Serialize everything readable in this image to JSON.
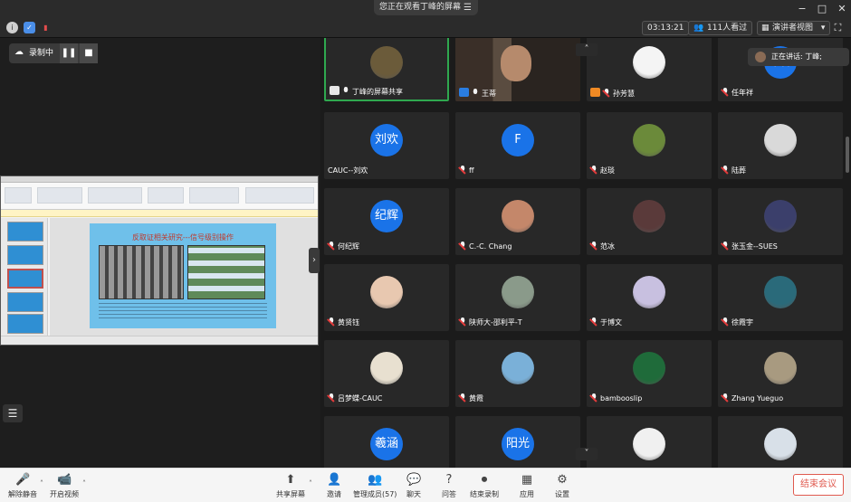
{
  "window": {
    "title": "您正在观看丁峰的屏幕",
    "menu_icon": "menu-icon",
    "controls": [
      "−",
      "□",
      "✕"
    ]
  },
  "toolbar": {
    "timer": "03:13:21",
    "viewer_count": "111人看过",
    "view_mode": "演讲者视图",
    "view_caret": "▾"
  },
  "recording": {
    "label": "录制中",
    "pause_icon": "❚❚",
    "stop_icon": "■"
  },
  "slide": {
    "title": "反取证相关研究---信号级别操作"
  },
  "speaking": {
    "text": "正在讲话: 丁峰;"
  },
  "participants": [
    {
      "name": "丁峰的屏幕共享",
      "kind": "share",
      "avatar": "img",
      "color": "#6b5b3a",
      "muted": false,
      "active": true,
      "icon": "screen-share-icon"
    },
    {
      "name": "王蒂",
      "kind": "host",
      "avatar": "video",
      "color": "#4a4440",
      "muted": false,
      "icon": "host-icon"
    },
    {
      "name": "孙芳慧",
      "kind": "cohost",
      "avatar": "img",
      "color": "#f4f4f4",
      "muted": true,
      "icon": "cohost-icon"
    },
    {
      "name": "任年祥",
      "avatar": "text",
      "text": "年祥",
      "color": "#1a73e8",
      "muted": true
    },
    {
      "name": "CAUC--刘欢",
      "avatar": "text",
      "text": "刘欢",
      "color": "#1a73e8",
      "muted": null
    },
    {
      "name": "ff",
      "avatar": "text",
      "text": "F",
      "color": "#1a73e8",
      "muted": true
    },
    {
      "name": "赵琰",
      "avatar": "img",
      "color": "#6b8a3a",
      "muted": true
    },
    {
      "name": "陆葬",
      "avatar": "img",
      "color": "#d9d9d9",
      "muted": true
    },
    {
      "name": "何纪辉",
      "avatar": "text",
      "text": "纪辉",
      "color": "#1a73e8",
      "muted": true
    },
    {
      "name": "C.-C. Chang",
      "avatar": "img",
      "color": "#c4876a",
      "muted": true
    },
    {
      "name": "范冰",
      "avatar": "img",
      "color": "#5a3a3a",
      "muted": true
    },
    {
      "name": "张玉金--SUES",
      "avatar": "img",
      "color": "#3b3f6b",
      "muted": true
    },
    {
      "name": "黄贤钰",
      "avatar": "img",
      "color": "#e8c8b0",
      "muted": true
    },
    {
      "name": "陕师大-邵利平-T",
      "avatar": "img",
      "color": "#8a9a8a",
      "muted": true
    },
    {
      "name": "于博文",
      "avatar": "img",
      "color": "#c8c0e0",
      "muted": true
    },
    {
      "name": "徐霞宇",
      "avatar": "img",
      "color": "#2a6a7a",
      "muted": true
    },
    {
      "name": "吕梦蝶-CAUC",
      "avatar": "img",
      "color": "#e8e0d0",
      "muted": true
    },
    {
      "name": "黄霞",
      "avatar": "img",
      "color": "#7ab0d8",
      "muted": true
    },
    {
      "name": "bambooslip",
      "avatar": "img",
      "color": "#1f6b3a",
      "muted": true
    },
    {
      "name": "Zhang Yueguo",
      "avatar": "img",
      "color": "#a89a80",
      "muted": true
    },
    {
      "name": "",
      "avatar": "text",
      "text": "羲涵",
      "color": "#1a73e8",
      "muted": null
    },
    {
      "name": "",
      "avatar": "text",
      "text": "阳光",
      "color": "#1a73e8",
      "muted": null
    },
    {
      "name": "",
      "avatar": "img",
      "color": "#f0f0f0",
      "muted": null
    },
    {
      "name": "",
      "avatar": "img",
      "color": "#d8e0e8",
      "muted": null
    }
  ],
  "bottom": {
    "unmute": "解除静音",
    "start_video": "开启视频",
    "share_screen": "共享屏幕",
    "invite": "邀请",
    "manage_members": "管理成员(57)",
    "chat": "聊天",
    "qa": "问答",
    "end_recording": "结束录制",
    "apps": "应用",
    "settings": "设置",
    "end_meeting": "结束会议"
  }
}
